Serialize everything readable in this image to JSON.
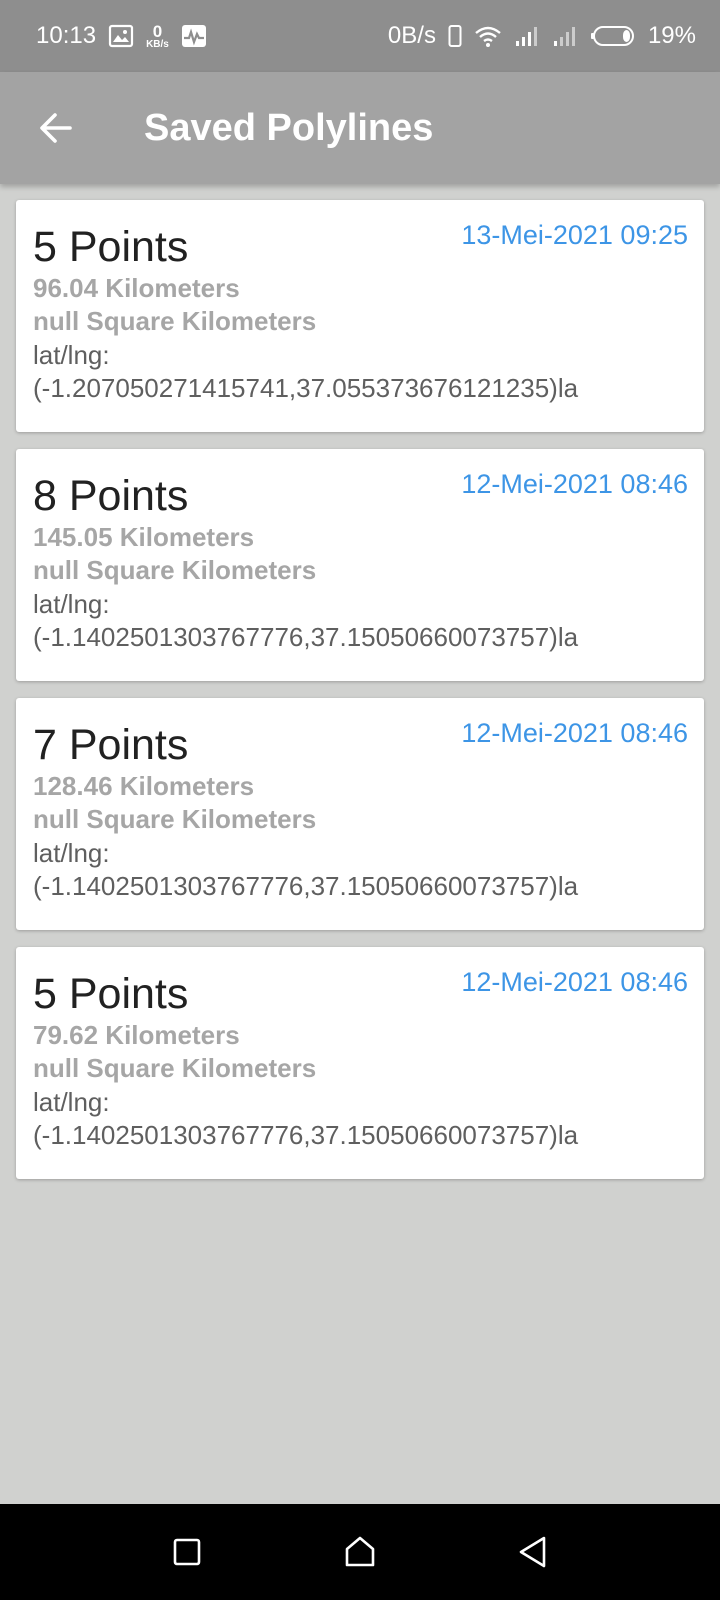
{
  "status_bar": {
    "time": "10:13",
    "kbs_value": "0",
    "kbs_unit": "KB/s",
    "net_speed": "0B/s",
    "battery": "19%",
    "icons": [
      "image-icon",
      "activity-icon",
      "phone-outline-icon",
      "wifi-icon",
      "signal-icon",
      "signal-icon",
      "battery-icon"
    ]
  },
  "app_bar": {
    "title": "Saved Polylines",
    "back_icon": "arrow-left-icon"
  },
  "polylines": [
    {
      "points": "5 Points",
      "date": "13-Mei-2021 09:25",
      "distance": "96.04 Kilometers",
      "area": "null  Square Kilometers",
      "latlng_label": "lat/lng:",
      "latlng_value": "(-1.207050271415741,37.05537367612123​5)la"
    },
    {
      "points": "8 Points",
      "date": "12-Mei-2021 08:46",
      "distance": "145.05 Kilometers",
      "area": "null  Square Kilometers",
      "latlng_label": "lat/lng:",
      "latlng_value": "(-1.1402501303767776,37.15050660073757)la"
    },
    {
      "points": "7 Points",
      "date": "12-Mei-2021 08:46",
      "distance": "128.46 Kilometers",
      "area": "null  Square Kilometers",
      "latlng_label": "lat/lng:",
      "latlng_value": "(-1.1402501303767776,37.15050660073757)la"
    },
    {
      "points": "5 Points",
      "date": "12-Mei-2021 08:46",
      "distance": "79.62 Kilometers",
      "area": "null  Square Kilometers",
      "latlng_label": "lat/lng:",
      "latlng_value": "(-1.1402501303767776,37.15050660073757)la"
    }
  ],
  "nav_bar": {
    "icons": [
      "recents-square-icon",
      "home-icon",
      "back-triangle-icon"
    ]
  },
  "colors": {
    "status_bar": "#8e8e8e",
    "app_bar": "#a3a3a3",
    "background": "#d0d1cf",
    "date_accent": "#3d95e6"
  }
}
